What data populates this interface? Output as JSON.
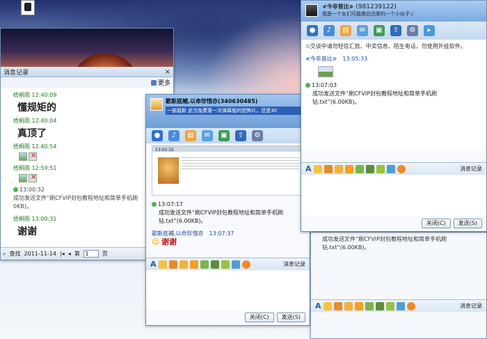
{
  "hist": {
    "title": "消息记录",
    "close": "×",
    "more": "更多",
    "entries": [
      {
        "sender": "梧桐雨",
        "time": "12:40:09",
        "text": "懂规矩的"
      },
      {
        "sender": "梧桐雨",
        "time": "12:40:04",
        "text": "真顶了"
      },
      {
        "sender": "梧桐雨",
        "time": "12:40:54"
      },
      {
        "sender": "梧桐雨",
        "time": "12:59:51"
      }
    ],
    "sys_time": "13:00:32",
    "sys_line1": "成功发送文件“刷CFVIP封包教程地址和简单手机刷",
    "sys_line2": "0KB)。",
    "last_sender": "梧桐雨",
    "last_time": "13:00:31",
    "last_text": "谢谢",
    "pager": {
      "find": "查找",
      "date": "2011-11-14",
      "page_label": "第",
      "page": "1",
      "page_suffix": "页"
    }
  },
  "chatB": {
    "name": "歌斯底補,以命珍惜亦(340630485)",
    "scroll": "一部聂新 武当免费看一次弹幕般的恐怖片。还是30",
    "screen_time": "13:02:32",
    "sys_time": "13:07:17",
    "sys_line1": "成功发送文件“刷CFVIP封包教程地址和简单手机刷",
    "sys_line2": "钻.txt”(6.00KB)。",
    "sender": "歌斯底補,以命珍惜亦",
    "sender_time": "13:07:37",
    "reply": "谢谢",
    "history_btn": "消息记录",
    "close_btn": "关闭(C)",
    "send_btn": "发送(S)"
  },
  "chatC": {
    "name": "≮今非昔比≯",
    "qq": "(981239122)",
    "sig": "我是一个女们可能南泊泊爱的一个小伙子:/",
    "warn": "交谈中请勿轻信汇款、中奖信息、陌生电话，勿使用外挂软件。",
    "sender": "≮今非昔比≯",
    "sender_time": "13:05:33",
    "sys_time": "13:07:03",
    "sys_line1": "成功发送文件“刷CFVIP封包教程地址和简单手机刷",
    "sys_line2": "钻.txt”(6.00KB)。",
    "history_btn": "消息记录",
    "close_btn": "关闭(C)",
    "send_btn": "发送(S)"
  },
  "chatD": {
    "line1": "成功发送文件“刷CFVIP封包教程地址和简单手机刷",
    "line2": "钻.txt”(6.00KB)。",
    "history_btn": "消息记录"
  }
}
